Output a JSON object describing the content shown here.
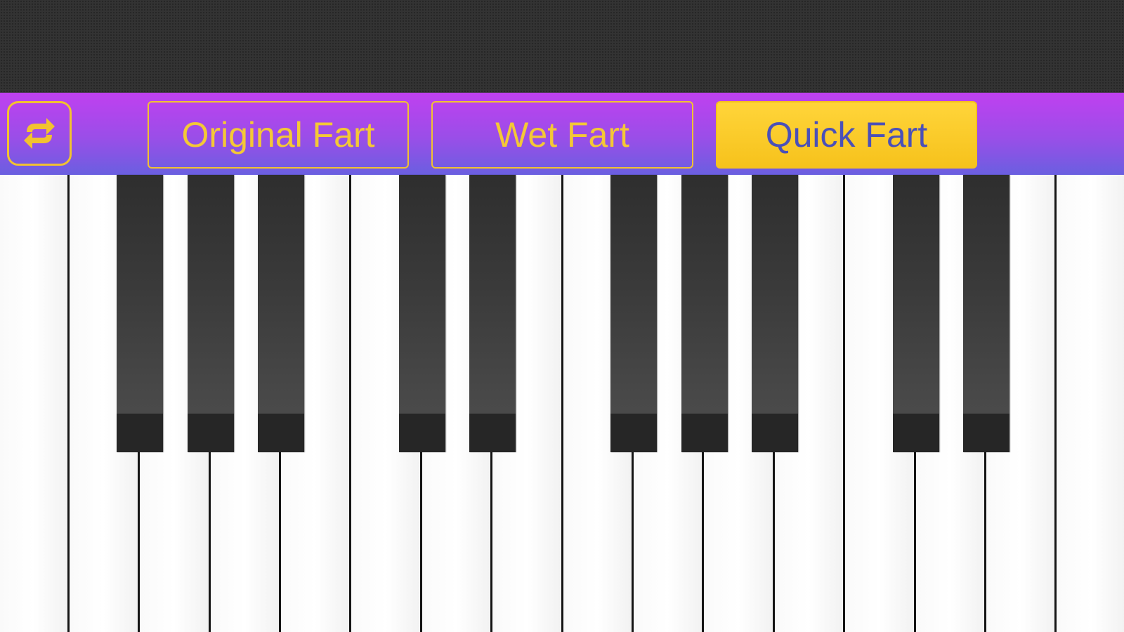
{
  "toolbar": {
    "switch_icon": "refresh-icon",
    "buttons": [
      {
        "label": "Original Fart",
        "active": false
      },
      {
        "label": "Wet Fart",
        "active": false
      },
      {
        "label": "Quick Fart",
        "active": true
      }
    ]
  },
  "keyboard": {
    "white_key_count": 17,
    "black_key_groups": [
      3,
      2,
      3,
      2
    ],
    "colors": {
      "toolbar_top": "#c040f0",
      "toolbar_bottom": "#6a5fe0",
      "accent_gold": "#f6c21c",
      "active_text": "#4a50b8"
    }
  }
}
